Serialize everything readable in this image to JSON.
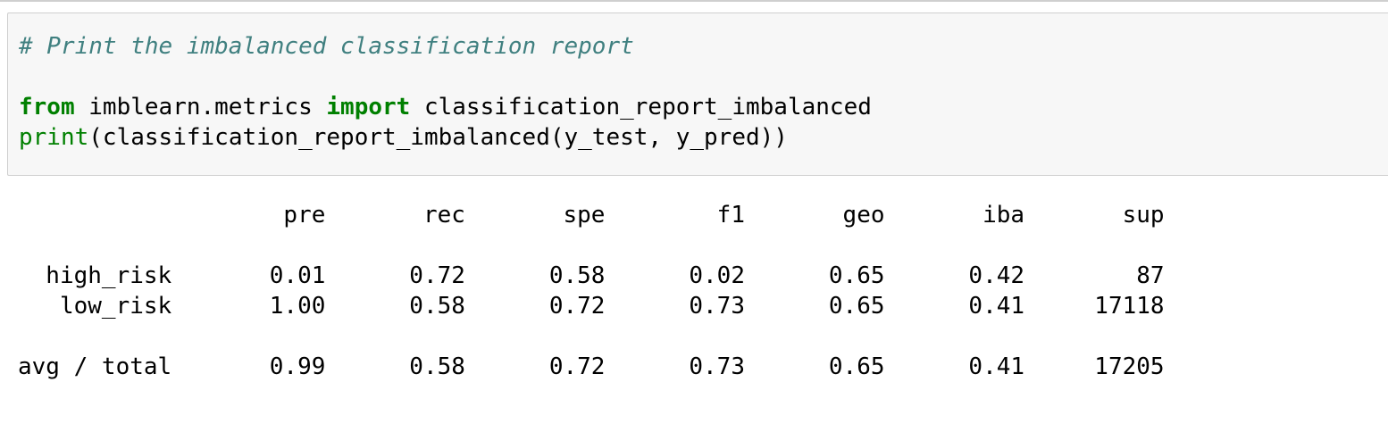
{
  "input_cell": {
    "comment": "# Print the imbalanced classification report",
    "line2": {
      "kw_from": "from",
      "module": " imblearn.metrics ",
      "kw_import": "import",
      "name": " classification_report_imbalanced"
    },
    "line3": {
      "builtin": "print",
      "rest": "(classification_report_imbalanced(y_test, y_pred))"
    }
  },
  "output": {
    "header": "                   pre       rec       spe        f1       geo       iba       sup",
    "blank1": "",
    "row_high_risk": "  high_risk       0.01      0.72      0.58      0.02      0.65      0.42        87",
    "row_low_risk": "   low_risk       1.00      0.58      0.72      0.73      0.65      0.41     17118",
    "blank2": "",
    "row_avg_total": "avg / total       0.99      0.58      0.72      0.73      0.65      0.41     17205"
  },
  "report": {
    "columns": [
      "pre",
      "rec",
      "spe",
      "f1",
      "geo",
      "iba",
      "sup"
    ],
    "rows": [
      {
        "label": "high_risk",
        "values": [
          "0.01",
          "0.72",
          "0.58",
          "0.02",
          "0.65",
          "0.42",
          "87"
        ]
      },
      {
        "label": "low_risk",
        "values": [
          "1.00",
          "0.58",
          "0.72",
          "0.73",
          "0.65",
          "0.41",
          "17118"
        ]
      },
      {
        "label": "avg / total",
        "values": [
          "0.99",
          "0.58",
          "0.72",
          "0.73",
          "0.65",
          "0.41",
          "17205"
        ]
      }
    ]
  },
  "colors": {
    "comment": "#408080",
    "keyword": "#008000",
    "cell_background": "#f7f7f7",
    "cell_border": "#cfcfcf"
  }
}
